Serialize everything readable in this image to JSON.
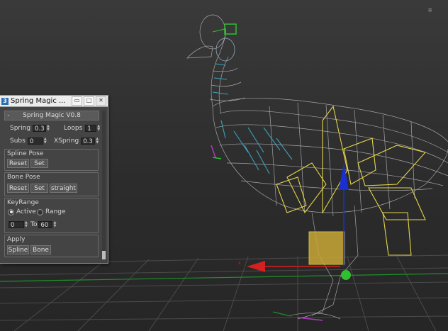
{
  "window": {
    "title": "Spring Magic ...",
    "minimize_glyph": "▭",
    "maximize_glyph": "□",
    "close_glyph": "✕"
  },
  "viewport": {
    "viewcube_text": "≡"
  },
  "panel": {
    "header_minus": "-",
    "header_title": "Spring Magic V0.8",
    "spring_label": "Spring",
    "spring_value": "0.3",
    "loops_label": "Loops",
    "loops_value": "1",
    "subs_label": "Subs",
    "subs_value": "0",
    "xspring_label": "XSpring",
    "xspring_value": "0.3",
    "spline_pose": {
      "label": "Spline Pose",
      "reset": "Reset",
      "set": "Set"
    },
    "bone_pose": {
      "label": "Bone Pose",
      "reset": "Reset",
      "set": "Set",
      "straight": "straight"
    },
    "keyrange": {
      "label": "KeyRange",
      "active_label": "Active",
      "range_label": "Range",
      "selected": "Active",
      "from_value": "0",
      "to_label": "To",
      "to_value": "60"
    },
    "apply": {
      "label": "Apply",
      "spline": "Spline",
      "bone": "Bone"
    }
  },
  "colors": {
    "viewport_bg": "#2e2e2e",
    "wire_gray": "#b9b9b9",
    "wire_cyan": "#3fb6d6",
    "bone_yellow": "#e6d64a",
    "gizmo_red": "#d42020",
    "gizmo_blue": "#1a2fd0",
    "gizmo_green": "#2fbf2f"
  }
}
